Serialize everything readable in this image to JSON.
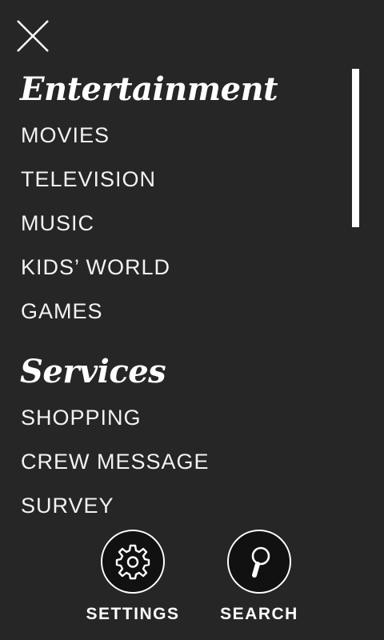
{
  "header": {
    "close_icon": "close-icon"
  },
  "menu": {
    "sections": [
      {
        "title": "Entertainment",
        "items": [
          "MOVIES",
          "TELEVISION",
          "MUSIC",
          "KIDS’ WORLD",
          "GAMES"
        ]
      },
      {
        "title": "Services",
        "items": [
          "SHOPPING",
          "CREW MESSAGE",
          "SURVEY"
        ]
      }
    ],
    "scroll_position_fraction": 0.0
  },
  "bottom_bar": {
    "settings": {
      "label": "SETTINGS",
      "icon": "gear-icon"
    },
    "search": {
      "label": "SEARCH",
      "icon": "search-icon"
    }
  },
  "colors": {
    "background": "#262626",
    "text": "#ffffff",
    "button_fill": "#111111"
  }
}
